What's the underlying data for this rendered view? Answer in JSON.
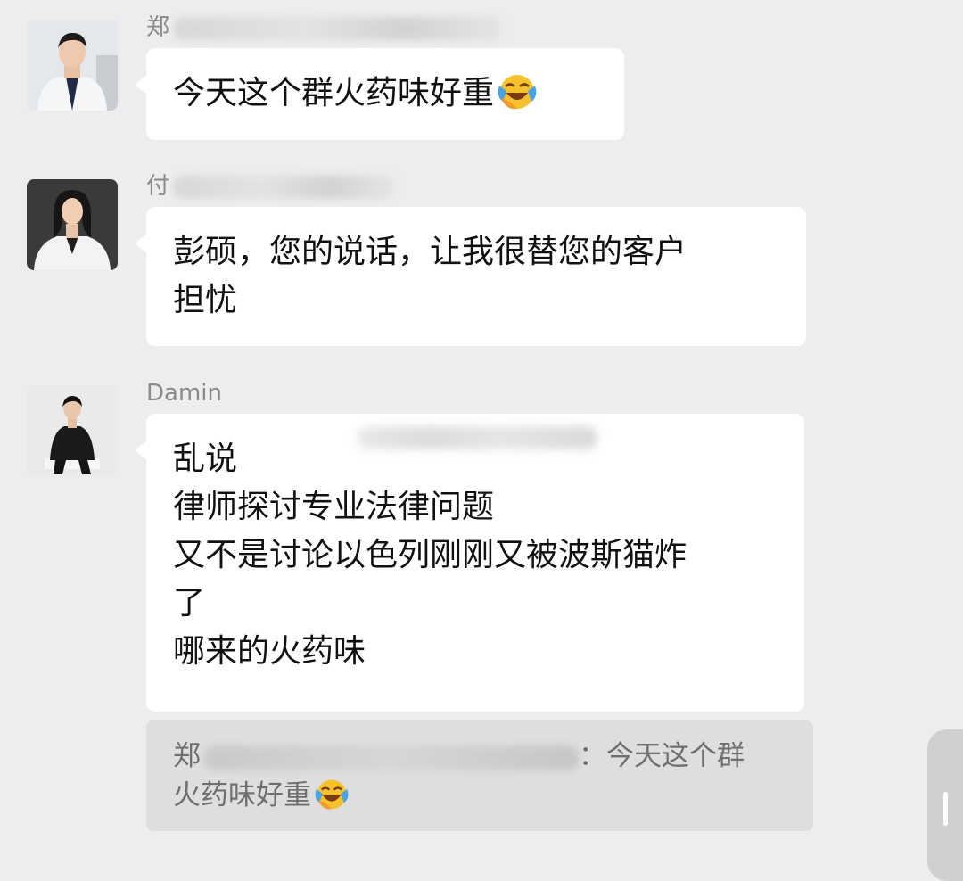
{
  "messages": [
    {
      "sender_visible": "郑",
      "lines": [
        "今天这个群火药味好重"
      ],
      "emoji": "face-with-tears-of-joy"
    },
    {
      "sender_visible": "付",
      "lines": [
        "彭硕，您的说话，让我很替您的客户",
        "担忧"
      ]
    },
    {
      "sender_visible": "Damin",
      "lines": [
        "乱说",
        "律师探讨专业法律问题",
        "又不是讨论以色列刚刚又被波斯猫炸",
        "了",
        "哪来的火药味"
      ]
    }
  ],
  "quote": {
    "sender_visible": "郑",
    "separator": "：",
    "lines": [
      "今天这个群",
      "火药味好重"
    ],
    "emoji": "face-with-tears-of-joy"
  },
  "colors": {
    "background": "#ededed",
    "bubble": "#ffffff",
    "quote_background": "#dedede",
    "sender_text": "#8a8a8a",
    "quote_text": "#6f6f6f"
  }
}
